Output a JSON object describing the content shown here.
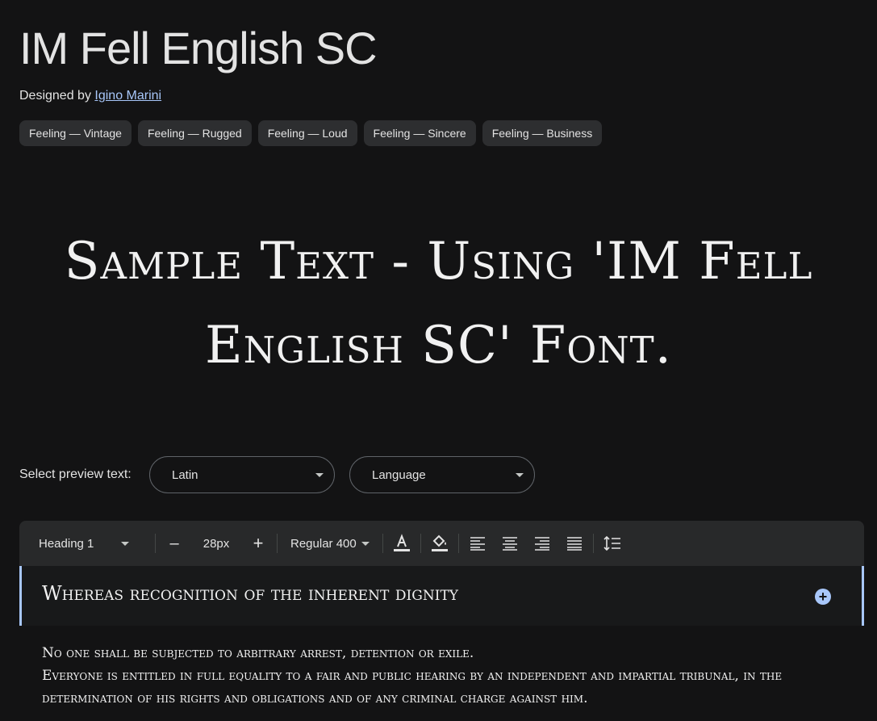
{
  "font": {
    "name": "IM Fell English SC",
    "designed_by_label": "Designed by",
    "designer": "Igino Marini"
  },
  "tags": [
    "Feeling — Vintage",
    "Feeling — Rugged",
    "Feeling — Loud",
    "Feeling — Sincere",
    "Feeling — Business"
  ],
  "hero": {
    "line1": "Sample Text - Using 'IM Fell",
    "line2": "English SC' Font."
  },
  "preview": {
    "label": "Select preview text:",
    "script_value": "Latin",
    "language_value": "Language"
  },
  "toolbar": {
    "style_value": "Heading 1",
    "minus": "–",
    "size_value": "28px",
    "plus": "+",
    "weight_value": "Regular 400"
  },
  "editor": {
    "heading": "Whereas recognition of the inherent dignity",
    "add": "+"
  },
  "body": {
    "line1": "No one shall be subjected to arbitrary arrest, detention or exile.",
    "line2": "Everyone is entitled in full equality to a fair and public hearing by an independent and impartial tribunal, in the determination of his rights and obligations and of any criminal charge against him."
  },
  "colors": {
    "background": "#131314",
    "accent": "#a8c7fa",
    "chip": "#2d2e30",
    "toolbar": "#28292a"
  }
}
